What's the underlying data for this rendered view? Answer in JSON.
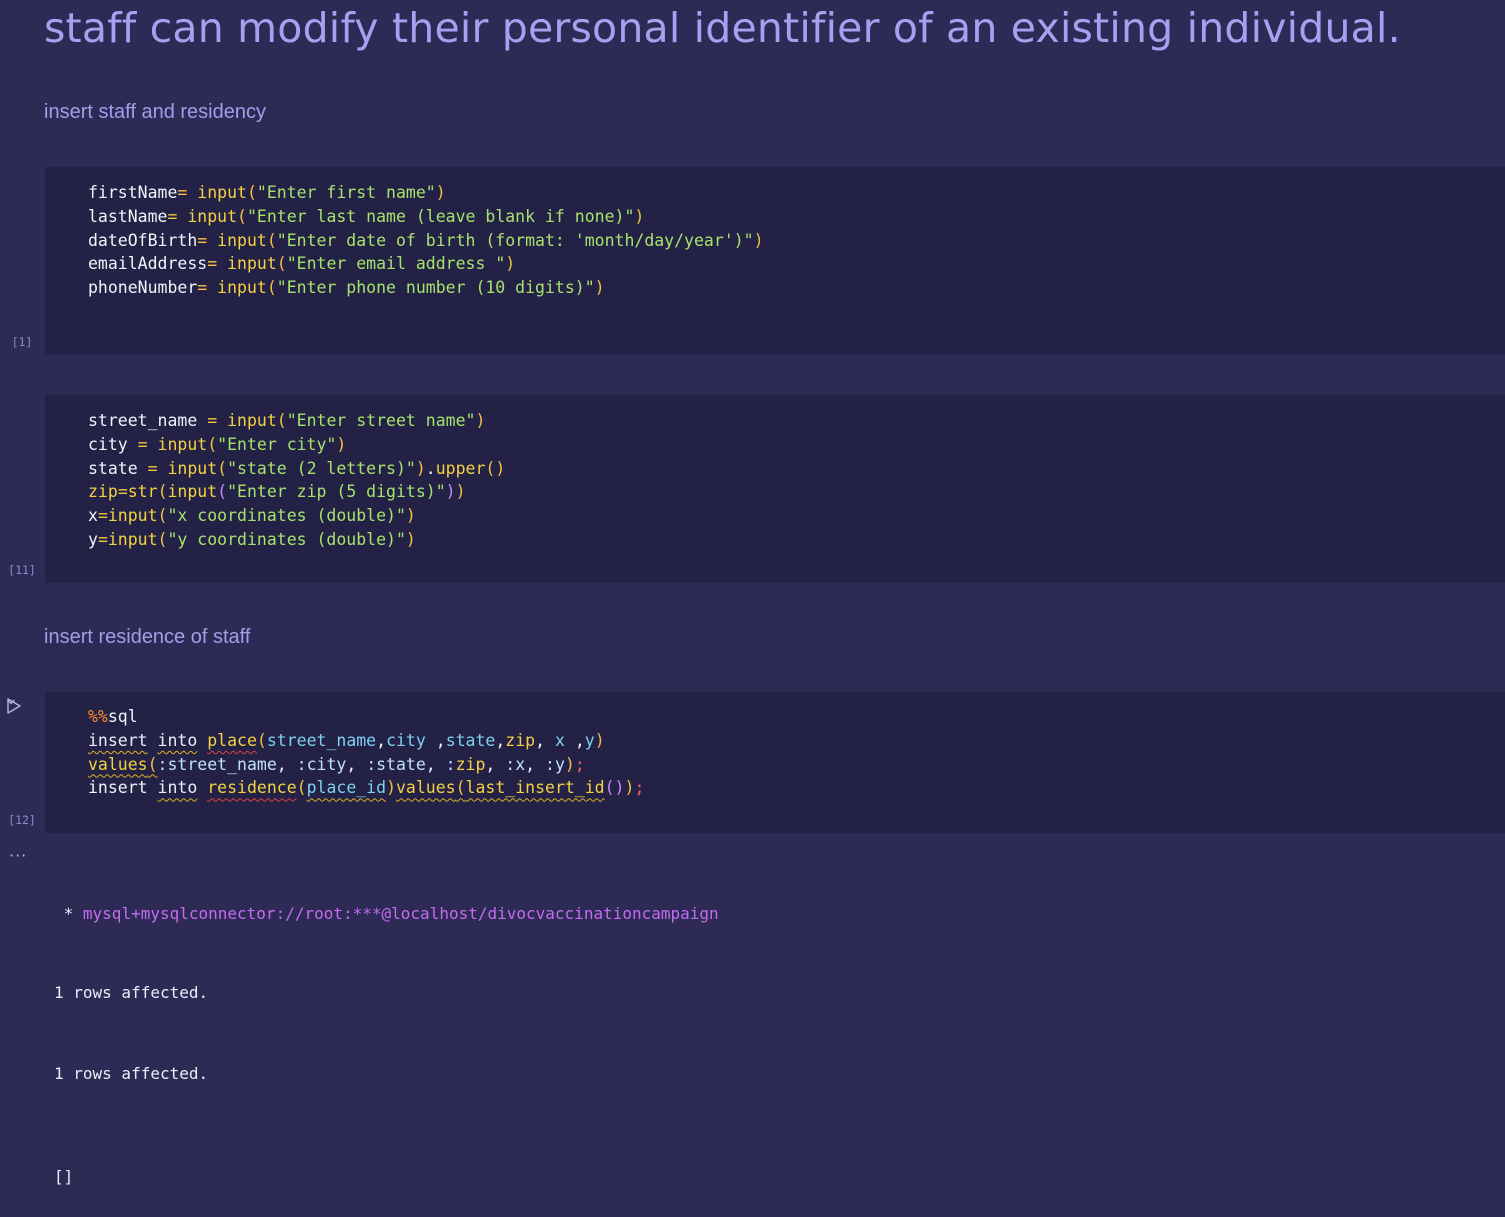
{
  "markdown": {
    "title": "staff can modify their personal identifier of an existing individual.",
    "heading1": "insert staff and residency",
    "heading2": "insert residence of staff"
  },
  "cells": [
    {
      "exec_count": "[1]",
      "lines": [
        [
          [
            "var",
            "firstName"
          ],
          [
            "op",
            "="
          ],
          [
            "var",
            " "
          ],
          [
            "fn",
            "input"
          ],
          [
            "paren",
            "("
          ],
          [
            "str",
            "\"Enter first name\""
          ],
          [
            "paren",
            ")"
          ]
        ],
        [
          [
            "var",
            "lastName"
          ],
          [
            "op",
            "="
          ],
          [
            "var",
            " "
          ],
          [
            "fn",
            "input"
          ],
          [
            "paren",
            "("
          ],
          [
            "str",
            "\"Enter last name (leave blank if none)\""
          ],
          [
            "paren",
            ")"
          ]
        ],
        [
          [
            "var",
            "dateOfBirth"
          ],
          [
            "op",
            "="
          ],
          [
            "var",
            " "
          ],
          [
            "fn",
            "input"
          ],
          [
            "paren",
            "("
          ],
          [
            "str",
            "\"Enter date of birth (format: 'month/day/year')\""
          ],
          [
            "paren",
            ")"
          ]
        ],
        [
          [
            "var",
            "emailAddress"
          ],
          [
            "op",
            "="
          ],
          [
            "var",
            " "
          ],
          [
            "fn",
            "input"
          ],
          [
            "paren",
            "("
          ],
          [
            "str",
            "\"Enter email address \""
          ],
          [
            "paren",
            ")"
          ]
        ],
        [
          [
            "var",
            "phoneNumber"
          ],
          [
            "op",
            "="
          ],
          [
            "var",
            " "
          ],
          [
            "fn",
            "input"
          ],
          [
            "paren",
            "("
          ],
          [
            "str",
            "\"Enter phone number (10 digits)\""
          ],
          [
            "paren",
            ")"
          ]
        ]
      ]
    },
    {
      "exec_count": "[11]",
      "lines": [
        [
          [
            "var",
            "street_name "
          ],
          [
            "op",
            "="
          ],
          [
            "var",
            " "
          ],
          [
            "fn",
            "input"
          ],
          [
            "paren",
            "("
          ],
          [
            "str",
            "\"Enter street name\""
          ],
          [
            "paren",
            ")"
          ]
        ],
        [
          [
            "var",
            "city "
          ],
          [
            "op",
            "="
          ],
          [
            "var",
            " "
          ],
          [
            "fn",
            "input"
          ],
          [
            "paren",
            "("
          ],
          [
            "str",
            "\"Enter city\""
          ],
          [
            "paren",
            ")"
          ]
        ],
        [
          [
            "var",
            "state "
          ],
          [
            "op",
            "="
          ],
          [
            "var",
            " "
          ],
          [
            "fn",
            "input"
          ],
          [
            "paren",
            "("
          ],
          [
            "str",
            "\"state (2 letters)\""
          ],
          [
            "paren",
            ")"
          ],
          [
            "var",
            "."
          ],
          [
            "fn",
            "upper"
          ],
          [
            "paren",
            "()"
          ]
        ],
        [
          [
            "fn",
            "zip"
          ],
          [
            "op",
            "="
          ],
          [
            "fn",
            "str"
          ],
          [
            "paren",
            "("
          ],
          [
            "fn",
            "input"
          ],
          [
            "purple",
            "("
          ],
          [
            "str",
            "\"Enter zip (5 digits)\""
          ],
          [
            "purple",
            ")"
          ],
          [
            "paren",
            ")"
          ]
        ],
        [
          [
            "var",
            "x"
          ],
          [
            "op",
            "="
          ],
          [
            "fn",
            "input"
          ],
          [
            "paren",
            "("
          ],
          [
            "str",
            "\"x coordinates (double)\""
          ],
          [
            "paren",
            ")"
          ]
        ],
        [
          [
            "var",
            "y"
          ],
          [
            "op",
            "="
          ],
          [
            "fn",
            "input"
          ],
          [
            "paren",
            "("
          ],
          [
            "str",
            "\"y coordinates (double)\""
          ],
          [
            "paren",
            ")"
          ]
        ]
      ]
    },
    {
      "exec_count": "[12]",
      "lines": [
        [
          [
            "magic",
            "%%"
          ],
          [
            "var",
            "sql"
          ]
        ],
        [
          [
            "kw",
            "insert"
          ],
          [
            "var",
            " "
          ],
          [
            "kw",
            "into"
          ],
          [
            "var",
            " "
          ],
          [
            "err fn",
            "place"
          ],
          [
            "paren",
            "("
          ],
          [
            "cyan",
            "street_name"
          ],
          [
            "var",
            ","
          ],
          [
            "cyan",
            "city"
          ],
          [
            "var",
            " ,"
          ],
          [
            "cyan",
            "state"
          ],
          [
            "var",
            ","
          ],
          [
            "fn",
            "zip"
          ],
          [
            "var",
            ", "
          ],
          [
            "cyan",
            "x"
          ],
          [
            "var",
            " ,"
          ],
          [
            "cyan",
            "y"
          ],
          [
            "paren",
            ")"
          ]
        ],
        [
          [
            "warn fn",
            "values"
          ],
          [
            "paren warn",
            "("
          ],
          [
            "param",
            ":street_name"
          ],
          [
            "var",
            ", "
          ],
          [
            "param",
            ":city"
          ],
          [
            "var",
            ", "
          ],
          [
            "param",
            ":state"
          ],
          [
            "var",
            ", "
          ],
          [
            "param",
            ":"
          ],
          [
            "fn",
            "zip"
          ],
          [
            "var",
            ", "
          ],
          [
            "param",
            ":x"
          ],
          [
            "var",
            ", "
          ],
          [
            "param",
            ":y"
          ],
          [
            "paren",
            ")"
          ],
          [
            "red",
            ";"
          ]
        ],
        [
          [
            "var",
            "insert "
          ],
          [
            "kw",
            "into"
          ],
          [
            "var",
            " "
          ],
          [
            "err fn",
            "residence"
          ],
          [
            "paren",
            "("
          ],
          [
            "warn cyan",
            "place_id"
          ],
          [
            "paren",
            ")"
          ],
          [
            "warn fn",
            "values"
          ],
          [
            "paren warn",
            "("
          ],
          [
            "warn fn",
            "last_insert_id"
          ],
          [
            "purple",
            "()"
          ],
          [
            "paren",
            ")"
          ],
          [
            "red",
            ";"
          ]
        ]
      ]
    }
  ],
  "output": {
    "connection_prefix": " * ",
    "connection": "mysql+mysqlconnector://root:***@localhost/divocvaccinationcampaign",
    "line1": "1 rows affected.",
    "line2": "1 rows affected.",
    "line3": "[]",
    "more_icon": "ellipsis-icon"
  },
  "icons": {
    "run": "play-icon",
    "chevron": "chevron-down-icon"
  }
}
